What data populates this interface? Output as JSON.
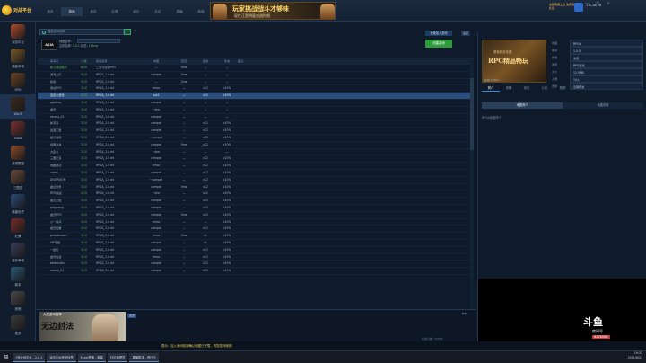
{
  "app": {
    "logo_text": "对战平台",
    "nav_tabs": [
      "首页",
      "游戏",
      "竞技",
      "比赛",
      "娱乐",
      "社区",
      "直播",
      "商城"
    ],
    "active_tab_index": 1,
    "banner": {
      "line1": "玩家挑战战斗才够味",
      "line2": "现在正是明星对战时刻"
    },
    "user_name": "1 8,18,18",
    "promo_text": "全新网游上线 免费领礼包",
    "window_controls": [
      "—",
      "□",
      "✕"
    ]
  },
  "sidebar": {
    "items": [
      {
        "label": "对战平台",
        "color": "#b34a2a"
      },
      {
        "label": "魔兽争霸",
        "color": "#7a5a2a"
      },
      {
        "label": "RPG",
        "color": "#6a4020"
      },
      {
        "label": "War3",
        "color": "#3a2a1a"
      },
      {
        "label": "DotA",
        "color": "#7a3030"
      },
      {
        "label": "英雄联盟",
        "color": "#8a4a2a"
      },
      {
        "label": "三国志",
        "color": "#6a4a3a"
      },
      {
        "label": "魔兽世界",
        "color": "#2a4a7a"
      },
      {
        "label": "红警",
        "color": "#7a2a2a"
      },
      {
        "label": "星际争霸",
        "color": "#3a3a5a"
      },
      {
        "label": "新手",
        "color": "#2a5a7a"
      },
      {
        "label": "其他",
        "color": "#4a4a4a"
      },
      {
        "label": "更多",
        "color": "#3a3a3a"
      }
    ],
    "active_index": 3
  },
  "filter": {
    "search_placeholder": "搜索房间名称",
    "favorite": "☆",
    "room_logo": "ASIA",
    "map_label": "地图名称:",
    "host_label": "主机名称:",
    "host_value": "1.0.1",
    "ping_label": "延迟:",
    "ping_value": "115ms",
    "quick_join": "快速加入游戏",
    "create_room": "创建游戏",
    "settings": "设置"
  },
  "table": {
    "headers": [
      "房间名",
      "人数",
      "房间名称",
      "地图",
      "延迟",
      "加载",
      "状态",
      "备注"
    ],
    "rows": [
      [
        "新人测试房间",
        "8/10",
        "二次元动漫RPG",
        "—",
        "0ms",
        "—",
        "—",
        ""
      ],
      [
        "游戏大厅",
        "3/10",
        "RPGA_1.0.rid",
        "compat",
        "2ms",
        "—",
        "—",
        ""
      ],
      [
        "新房",
        "3/10",
        "RPGA_1.0.rid",
        "—",
        "2ms",
        "—",
        "—",
        ""
      ],
      [
        "测试RPG",
        "3/10",
        "RPGA_1.0.rid",
        "rehca",
        "—",
        "x12",
        "x10%",
        ""
      ],
      [
        "自定义游戏",
        "3/10",
        "RPGA_1.0.rid",
        "sys2",
        "—",
        "x12",
        "x10%",
        ""
      ],
      [
        "gglobby",
        "3/10",
        "RPGA_1.0.rid",
        "compat",
        "—",
        "—",
        "—",
        ""
      ],
      [
        "魔兽",
        "3/10",
        "RPGA_1.0.rid",
        "~dne",
        "—",
        "—",
        "—",
        ""
      ],
      [
        "recess_01",
        "3/10",
        "RPGA_1.0.rid",
        "compat",
        "—",
        "—",
        "—",
        ""
      ],
      [
        "新手房",
        "3/10",
        "RPGA_1.0.rid",
        "compat",
        "—",
        "x12",
        "x10%",
        ""
      ],
      [
        "最强王者",
        "3/10",
        "RPGA_1.0.rid",
        "compat",
        "—",
        "x12",
        "x10%",
        ""
      ],
      [
        "娱乐房间",
        "3/10",
        "RPGA_1.0.rid",
        "~compat",
        "—",
        "x12",
        "x10%",
        ""
      ],
      [
        "经典对战",
        "3/10",
        "RPGA_1.0.rid",
        "compat",
        "5ms",
        "x12",
        "x10%",
        ""
      ],
      [
        "大乱斗",
        "3/10",
        "RPGA_1.0.rid",
        "~dne",
        "—",
        "—",
        "—",
        ""
      ],
      [
        "三国无双",
        "3/10",
        "RPGA_1.0.rid",
        "compat",
        "—",
        "x12",
        "x10%",
        ""
      ],
      [
        "地图测试",
        "3/10",
        "RPGA_1.0.rid",
        "rehca",
        "—",
        "x12",
        "x10%",
        ""
      ],
      [
        "comp",
        "3/10",
        "RPGA_1.0.rid",
        "compat",
        "—",
        "x12",
        "x10%",
        ""
      ],
      [
        "DIVERSION",
        "3/10",
        "RPGA_1.0.rid",
        "~compat",
        "—",
        "x12",
        "x10%",
        ""
      ],
      [
        "魔幻世界",
        "3/10",
        "RPGA_1.0.rid",
        "compat",
        "5ms",
        "x12",
        "x10%",
        ""
      ],
      [
        "RPG挑战",
        "3/10",
        "RPGA_1.0.rid",
        "~dne",
        "—",
        "x12",
        "x10%",
        ""
      ],
      [
        "魔幻大陆",
        "3/10",
        "RPGA_1.0.rid",
        "compat",
        "—",
        "x12",
        "x10%",
        ""
      ],
      [
        "pingpong",
        "3/10",
        "RPGA_1.0.rid",
        "compat",
        "—",
        "x12",
        "x10%",
        ""
      ],
      [
        "魔兽RPG",
        "3/10",
        "RPGA_1.0.rid",
        "compat",
        "5ms",
        "x12",
        "x10%",
        ""
      ],
      [
        "小一房间",
        "3/10",
        "RPGA_1.0.rid",
        "rehca",
        "—",
        "—",
        "x10%",
        ""
      ],
      [
        "魔兽英雄",
        "3/10",
        "RPGA_1.0.rid",
        "compat",
        "—",
        "x12",
        "x10%",
        ""
      ],
      [
        "peopleroom",
        "3/10",
        "RPGA_1.0.rid",
        "rehca",
        "5ms",
        "x1",
        "x10%",
        ""
      ],
      [
        "VIP专属",
        "3/10",
        "RPGA_1.0.rid",
        "compat",
        "—",
        "x1",
        "x10%",
        ""
      ],
      [
        "一起玩",
        "3/10",
        "RPGA_1.0.rid",
        "compat",
        "—",
        "x12",
        "x10%",
        ""
      ],
      [
        "魔兽对战",
        "3/10",
        "RPGA_1.0.rid",
        "rehca",
        "—",
        "x12",
        "x10%",
        ""
      ],
      [
        "tekkenalls",
        "3/10",
        "RPGA_1.0.rid",
        "compat",
        "—",
        "x12",
        "x10%",
        ""
      ],
      [
        "rooms_01",
        "3/10",
        "RPGA_1.0.rid",
        "compat",
        "—",
        "x12",
        "x10%",
        ""
      ]
    ],
    "selected_index": 4
  },
  "chat": {
    "promo_title": "无边封法",
    "promo_sub": "大型游戏推荐",
    "label": "发送",
    "status": "在线人数: 12345",
    "arrows": "◀ ▶"
  },
  "right_panel": {
    "banner_title": "RPG精品畅玩",
    "banner_sub": "魔兽精选地图",
    "banner_foot": "在线 11627",
    "info": [
      {
        "k": "地图",
        "v": "RPGA"
      },
      {
        "k": "版本",
        "v": "1.0.0"
      },
      {
        "k": "作者",
        "v": "未知"
      },
      {
        "k": "类型",
        "v": "RPG游戏"
      },
      {
        "k": "大小",
        "v": "12.5MB"
      },
      {
        "k": "人数",
        "v": "10人"
      },
      {
        "k": "更新",
        "v": "近期更新"
      }
    ],
    "tabs": [
      "简介",
      "攻略",
      "评论",
      "公告",
      "视频"
    ],
    "active_tab": 0,
    "subtabs": [
      "地图简介",
      "地图攻略"
    ],
    "active_subtab": 0,
    "text": "RPGA地图简介",
    "douyu": "斗鱼",
    "douyu_sub": "房间号",
    "douyu_id": "6226088"
  },
  "notice": "提示：加入房间前请确认地图已下载，祝您游戏愉快！",
  "taskbar": {
    "start": "⊞",
    "tasks": [
      "1号对战平台 - 2.0.1",
      "对战平台房间列表",
      "Excel表格 - 新建",
      "社区管理员",
      "直播推流 - 进行中"
    ],
    "time": "19:33",
    "date": "2021/8/21"
  }
}
